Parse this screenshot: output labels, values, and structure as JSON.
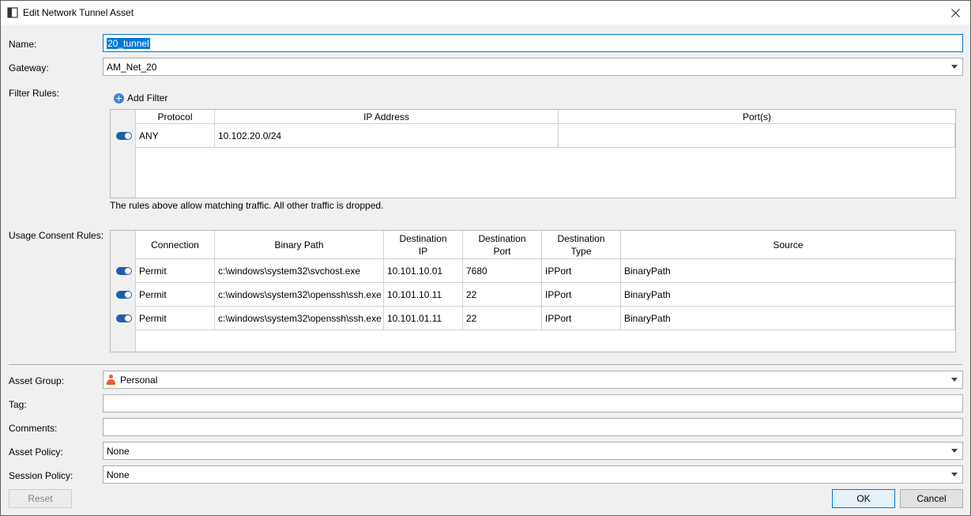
{
  "window": {
    "title": "Edit Network Tunnel Asset"
  },
  "form": {
    "name_label": "Name:",
    "name_value": "20_tunnel",
    "gateway_label": "Gateway:",
    "gateway_value": "AM_Net_20",
    "filter_rules_label": "Filter Rules:",
    "add_filter_label": "Add Filter",
    "usage_consent_label": "Usage Consent Rules:",
    "asset_group_label": "Asset Group:",
    "asset_group_value": "Personal",
    "tag_label": "Tag:",
    "tag_value": "",
    "comments_label": "Comments:",
    "comments_value": "",
    "asset_policy_label": "Asset Policy:",
    "asset_policy_value": "None",
    "session_policy_label": "Session Policy:",
    "session_policy_value": "None"
  },
  "filter_table": {
    "headers": [
      "Protocol",
      "IP Address",
      "Port(s)"
    ],
    "rows": [
      {
        "enabled": true,
        "protocol": "ANY",
        "ip": "10.102.20.0/24",
        "ports": ""
      }
    ],
    "note": "The rules above allow matching traffic. All other traffic is dropped."
  },
  "consent_table": {
    "headers": [
      "Connection",
      "Binary Path",
      "Destination IP",
      "Destination Port",
      "Destination Type",
      "Source"
    ],
    "header_lines": [
      [
        "Connection"
      ],
      [
        "Binary Path"
      ],
      [
        "Destination",
        "IP"
      ],
      [
        "Destination",
        "Port"
      ],
      [
        "Destination",
        "Type"
      ],
      [
        "Source"
      ]
    ],
    "rows": [
      {
        "enabled": true,
        "connection": "Permit",
        "binary": "c:\\windows\\system32\\svchost.exe",
        "dest_ip": "10.101.10.01",
        "dest_port": "7680",
        "dest_type": "IPPort",
        "source": "BinaryPath"
      },
      {
        "enabled": true,
        "connection": "Permit",
        "binary": "c:\\windows\\system32\\openssh\\ssh.exe",
        "dest_ip": "10.101.10.11",
        "dest_port": "22",
        "dest_type": "IPPort",
        "source": "BinaryPath"
      },
      {
        "enabled": true,
        "connection": "Permit",
        "binary": "c:\\windows\\system32\\openssh\\ssh.exe",
        "dest_ip": "10.101.01.11",
        "dest_port": "22",
        "dest_type": "IPPort",
        "source": "BinaryPath"
      }
    ]
  },
  "buttons": {
    "reset": "Reset",
    "ok": "OK",
    "cancel": "Cancel"
  },
  "colors": {
    "accent": "#0078d7",
    "toggle_on": "#1f5fa8",
    "person_icon": "#e8602c"
  }
}
